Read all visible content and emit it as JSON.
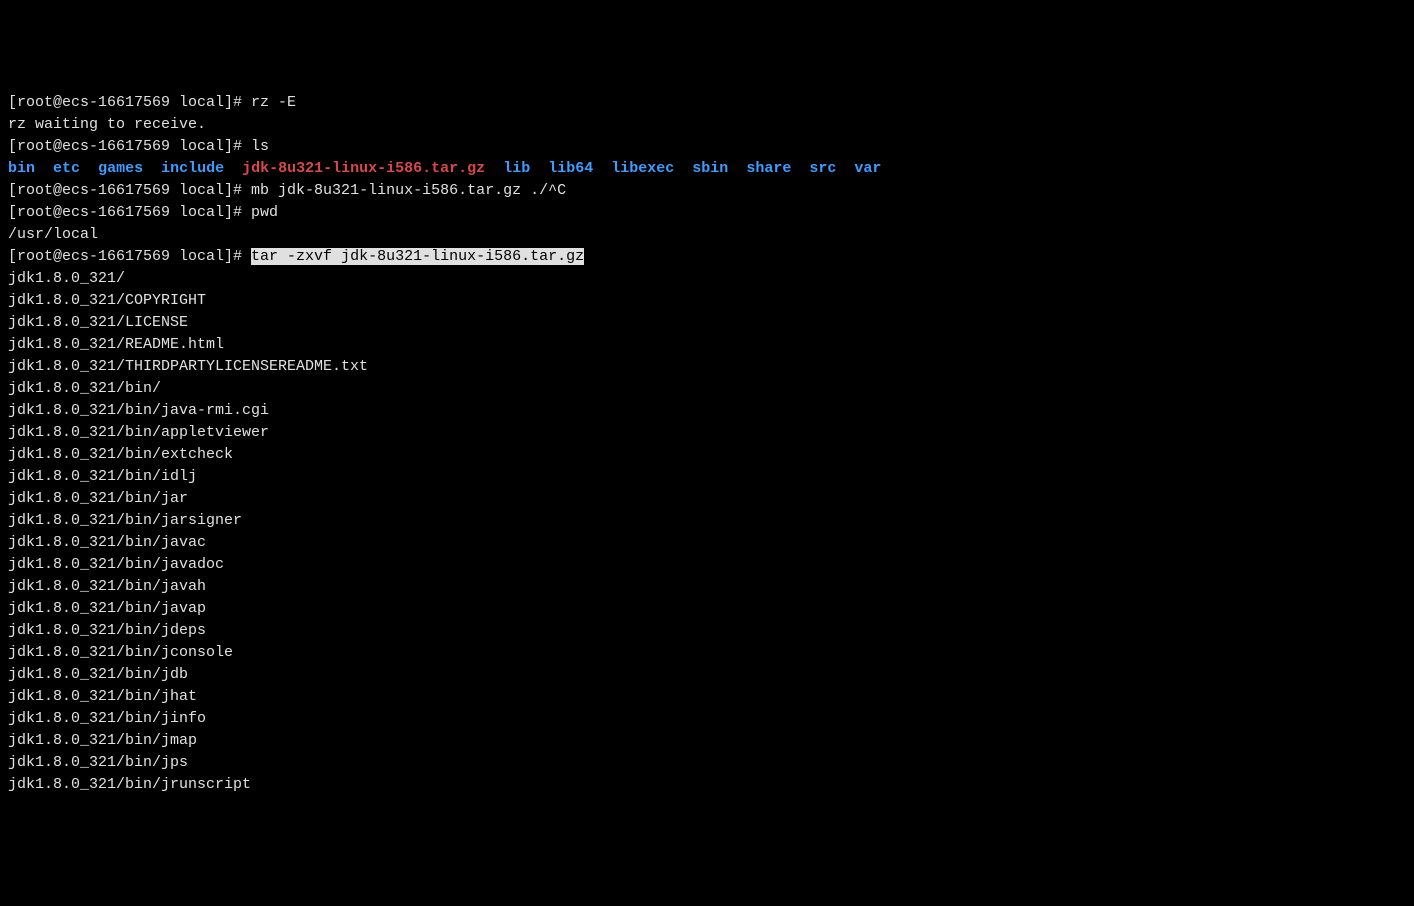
{
  "lines": {
    "l1_prompt": "[root@ecs-16617569 local]# ",
    "l1_cmd": "rz -E",
    "l2": "rz waiting to receive.",
    "l3_prompt": "[root@ecs-16617569 local]# ",
    "l3_cmd": "ls",
    "ls_items": {
      "bin": "bin",
      "etc": "etc",
      "games": "games",
      "include": "include",
      "jdk": "jdk-8u321-linux-i586.tar.gz",
      "lib": "lib",
      "lib64": "lib64",
      "libexec": "libexec",
      "sbin": "sbin",
      "share": "share",
      "src": "src",
      "var": "var"
    },
    "l5_prompt": "[root@ecs-16617569 local]# ",
    "l5_cmd": "mb jdk-8u321-linux-i586.tar.gz ./^C",
    "l6_prompt": "[root@ecs-16617569 local]# ",
    "l6_cmd": "pwd",
    "l7": "/usr/local",
    "l8_prompt": "[root@ecs-16617569 local]# ",
    "l8_cmd": "tar -zxvf jdk-8u321-linux-i586.tar.gz",
    "tar_output": [
      "jdk1.8.0_321/",
      "jdk1.8.0_321/COPYRIGHT",
      "jdk1.8.0_321/LICENSE",
      "jdk1.8.0_321/README.html",
      "jdk1.8.0_321/THIRDPARTYLICENSEREADME.txt",
      "jdk1.8.0_321/bin/",
      "jdk1.8.0_321/bin/java-rmi.cgi",
      "jdk1.8.0_321/bin/appletviewer",
      "jdk1.8.0_321/bin/extcheck",
      "jdk1.8.0_321/bin/idlj",
      "jdk1.8.0_321/bin/jar",
      "jdk1.8.0_321/bin/jarsigner",
      "jdk1.8.0_321/bin/javac",
      "jdk1.8.0_321/bin/javadoc",
      "jdk1.8.0_321/bin/javah",
      "jdk1.8.0_321/bin/javap",
      "jdk1.8.0_321/bin/jdeps",
      "jdk1.8.0_321/bin/jconsole",
      "jdk1.8.0_321/bin/jdb",
      "jdk1.8.0_321/bin/jhat",
      "jdk1.8.0_321/bin/jinfo",
      "jdk1.8.0_321/bin/jmap",
      "jdk1.8.0_321/bin/jps",
      "jdk1.8.0_321/bin/jrunscript"
    ]
  }
}
